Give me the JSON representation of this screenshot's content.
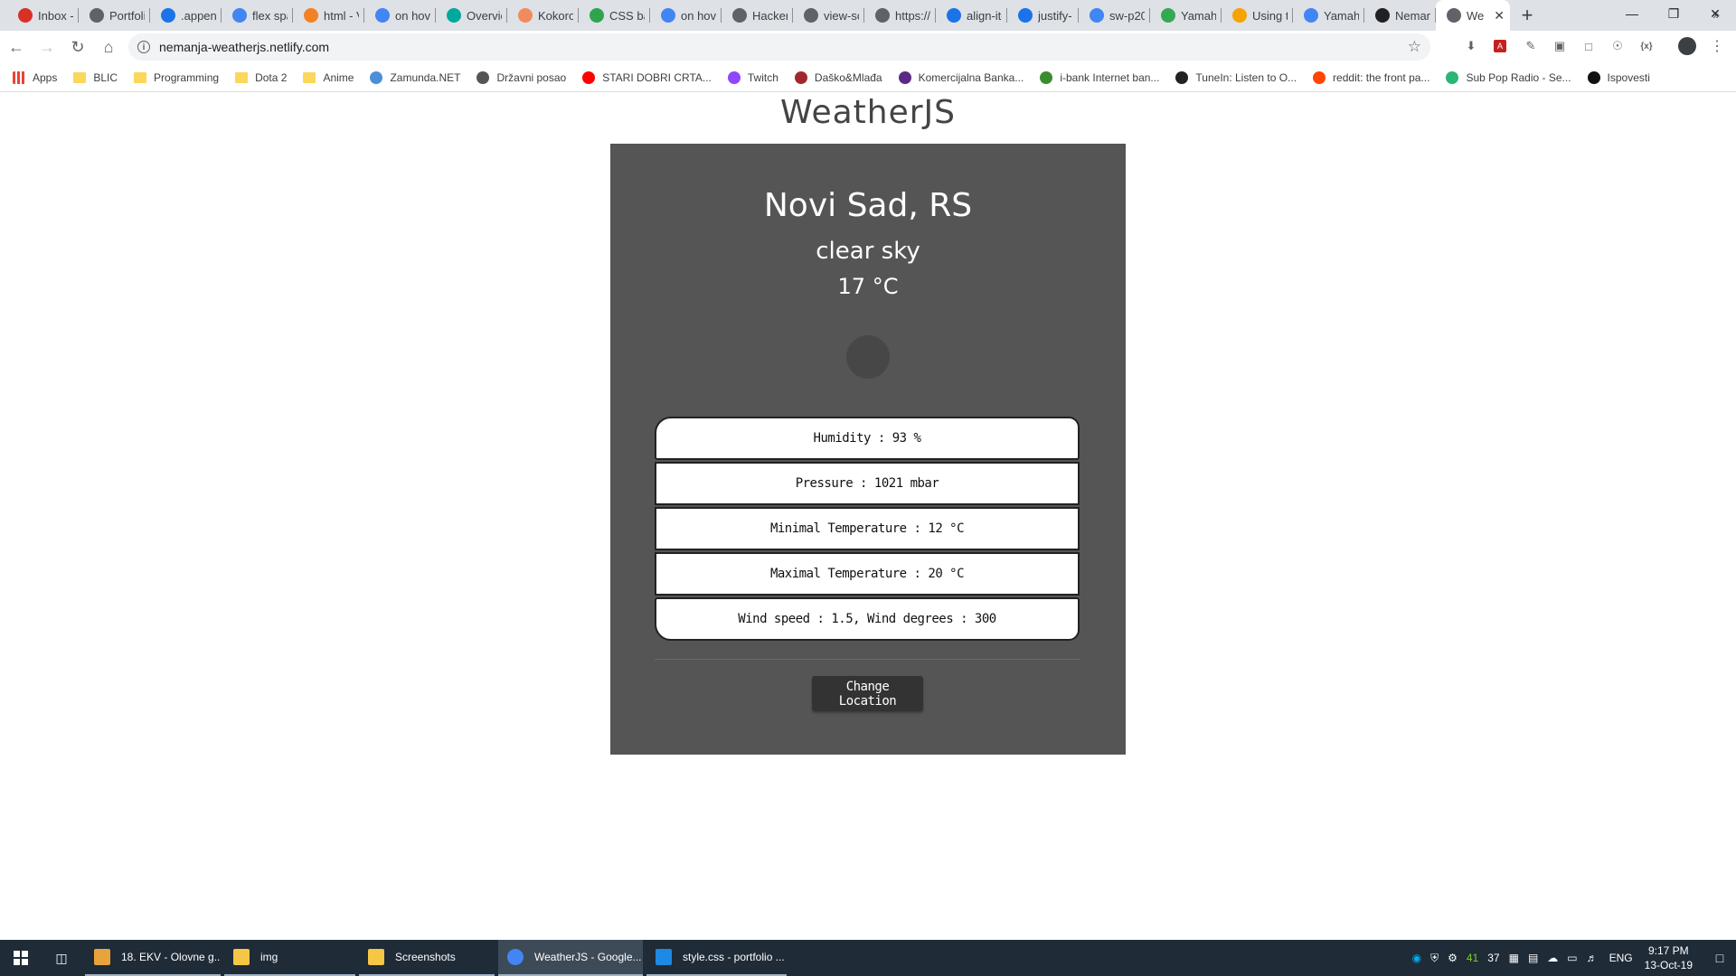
{
  "browser": {
    "tabs": [
      {
        "label": "Inbox -",
        "icon": "gmail-icon",
        "color": "#d93025"
      },
      {
        "label": "Portfoli",
        "icon": "globe-icon",
        "color": "#5f6368"
      },
      {
        "label": ".append",
        "icon": "moon-icon",
        "color": "#1a73e8"
      },
      {
        "label": "flex spa",
        "icon": "google-icon",
        "color": "#4285f4"
      },
      {
        "label": "html - V",
        "icon": "stackoverflow-icon",
        "color": "#f48024"
      },
      {
        "label": "on hove",
        "icon": "google-icon",
        "color": "#4285f4"
      },
      {
        "label": "Overvie",
        "icon": "diamond-icon",
        "color": "#00a99d"
      },
      {
        "label": "Kokoro",
        "icon": "kokoro-icon",
        "color": "#f28b5b"
      },
      {
        "label": "CSS ba",
        "icon": "css-icon",
        "color": "#2ea44f"
      },
      {
        "label": "on hove",
        "icon": "google-icon",
        "color": "#4285f4"
      },
      {
        "label": "Hacker",
        "icon": "globe-icon",
        "color": "#5f6368"
      },
      {
        "label": "view-sc",
        "icon": "globe-icon",
        "color": "#5f6368"
      },
      {
        "label": "https://",
        "icon": "globe-icon",
        "color": "#5f6368"
      },
      {
        "label": "align-ite",
        "icon": "cap-icon",
        "color": "#1a73e8"
      },
      {
        "label": "justify-",
        "icon": "cap-icon",
        "color": "#1a73e8"
      },
      {
        "label": "sw-p20",
        "icon": "google-icon",
        "color": "#4285f4"
      },
      {
        "label": "Yamaha",
        "icon": "yamaha-icon",
        "color": "#34a853"
      },
      {
        "label": "Using t",
        "icon": "mozilla-icon",
        "color": "#f4a300"
      },
      {
        "label": "Yamaha",
        "icon": "google-icon",
        "color": "#4285f4"
      },
      {
        "label": "Neman",
        "icon": "github-icon",
        "color": "#202124"
      }
    ],
    "active_tab": {
      "label": "We",
      "icon": "globe-icon"
    },
    "url": "nemanja-weatherjs.netlify.com",
    "bookmarks": [
      {
        "label": "Apps",
        "kind": "apps"
      },
      {
        "label": "BLIC",
        "kind": "folder"
      },
      {
        "label": "Programming",
        "kind": "folder"
      },
      {
        "label": "Dota 2",
        "kind": "folder"
      },
      {
        "label": "Anime",
        "kind": "folder"
      },
      {
        "label": "Zamunda.NET",
        "kind": "site",
        "color": "#4a90d9"
      },
      {
        "label": "Državni posao",
        "kind": "site",
        "color": "#555555"
      },
      {
        "label": "STARI DOBRI CRTA...",
        "kind": "site",
        "color": "#ff0000"
      },
      {
        "label": "Twitch",
        "kind": "site",
        "color": "#9146ff"
      },
      {
        "label": "Daško&Mlađa",
        "kind": "site",
        "color": "#a0282d"
      },
      {
        "label": "Komercijalna Banka...",
        "kind": "site",
        "color": "#5b2a86"
      },
      {
        "label": "i-bank Internet ban...",
        "kind": "site",
        "color": "#3a8d2e"
      },
      {
        "label": "TuneIn: Listen to O...",
        "kind": "site",
        "color": "#222222"
      },
      {
        "label": "reddit: the front pa...",
        "kind": "site",
        "color": "#ff4500"
      },
      {
        "label": "Sub Pop Radio - Se...",
        "kind": "site",
        "color": "#2bb673"
      },
      {
        "label": "Ispovesti",
        "kind": "site",
        "color": "#111111"
      }
    ]
  },
  "page": {
    "app_title": "WeatherJS",
    "location": "Novi Sad, RS",
    "description": "clear sky",
    "temperature": "17 °C",
    "details": [
      "Humidity : 93 %",
      "Pressure : 1021 mbar",
      "Minimal Temperature : 12 °C",
      "Maximal Temperature : 20 °C",
      "Wind speed : 1.5, Wind degrees : 300"
    ],
    "change_button": "Change Location",
    "colors": {
      "card": "#555555",
      "button": "#333333"
    }
  },
  "taskbar": {
    "apps": [
      {
        "label": "18. EKV - Olovne g...",
        "icon": "winamp-icon",
        "color": "#e8a33d"
      },
      {
        "label": "img",
        "icon": "folder-icon",
        "color": "#f6c744"
      },
      {
        "label": "Screenshots",
        "icon": "folder-icon",
        "color": "#f6c744"
      },
      {
        "label": "WeatherJS - Google...",
        "icon": "chrome-icon",
        "color": "#4285f4"
      },
      {
        "label": "style.css - portfolio ...",
        "icon": "vscode-icon",
        "color": "#1e88e5"
      }
    ],
    "tray": {
      "cpu_temp": "41",
      "gpu_temp": "37",
      "language": "ENG",
      "time": "9:17 PM",
      "date": "13-Oct-19"
    }
  }
}
